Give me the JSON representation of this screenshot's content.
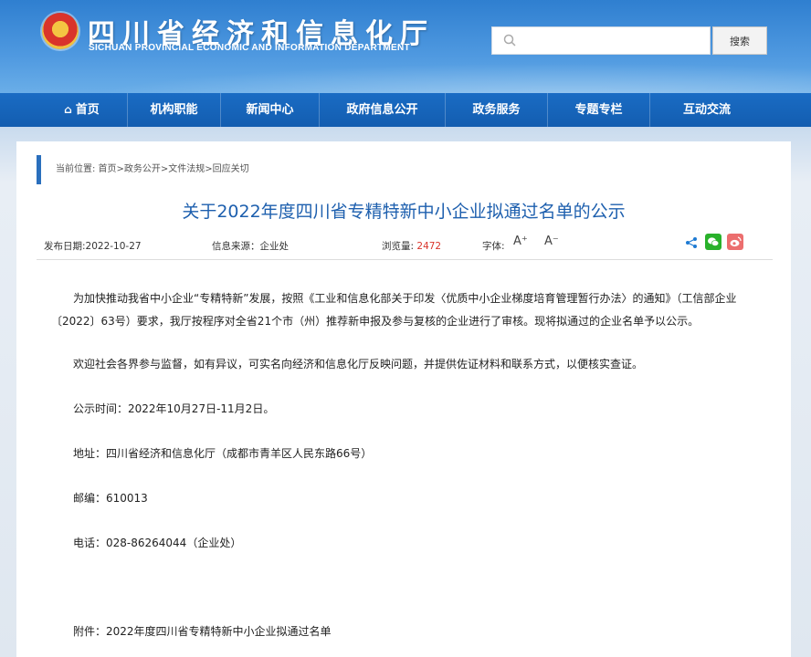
{
  "header": {
    "title": "四川省经济和信息化厅",
    "subtitle": "SICHUAN PROVINCIAL ECONOMIC AND INFORMATION DEPARTMENT",
    "search_placeholder": "",
    "search_button": "搜索"
  },
  "nav": {
    "items": [
      {
        "label": "首页"
      },
      {
        "label": "机构职能"
      },
      {
        "label": "新闻中心"
      },
      {
        "label": "政府信息公开"
      },
      {
        "label": "政务服务"
      },
      {
        "label": "专题专栏"
      },
      {
        "label": "互动交流"
      }
    ]
  },
  "breadcrumb": "当前位置: 首页>政务公开>文件法规>回应关切",
  "article": {
    "title": "关于2022年度四川省专精特新中小企业拟通过名单的公示",
    "publish_label": "发布日期:2022-10-27",
    "source_label": "信息来源：企业处",
    "views_label": "浏览量:",
    "views_count": "2472",
    "font_label": "字体:",
    "font_up": "A⁺",
    "font_down": "A⁻",
    "paragraphs": [
      "为加快推动我省中小企业“专精特新”发展，按照《工业和信息化部关于印发〈优质中小企业梯度培育管理暂行办法〉的通知》（工信部企业〔2022〕63号）要求，我厅按程序对全省21个市（州）推荐新申报及参与复核的企业进行了审核。现将拟通过的企业名单予以公示。",
      "欢迎社会各界参与监督，如有异议，可实名向经济和信息化厅反映问题，并提供佐证材料和联系方式，以便核实查证。",
      "公示时间：2022年10月27日-11月2日。",
      "地址：四川省经济和信息化厅（成都市青羊区人民东路66号）",
      "邮编：610013",
      "电话：028-86264044（企业处）",
      "附件：2022年度四川省专精特新中小企业拟通过名单"
    ]
  },
  "colors": {
    "accent": "#1d5fae",
    "nav_bg": "#135db0",
    "views_count": "#d9342b"
  }
}
